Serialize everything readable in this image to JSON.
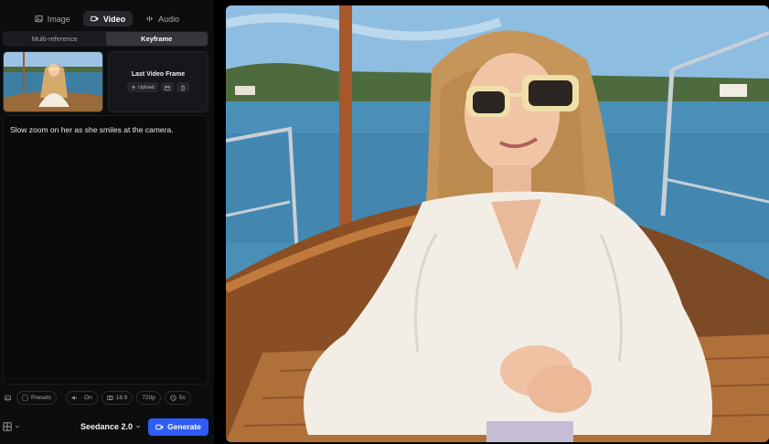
{
  "modes": [
    {
      "label": "Image",
      "icon": "image-icon",
      "active": false
    },
    {
      "label": "Video",
      "icon": "video-icon",
      "active": true
    },
    {
      "label": "Audio",
      "icon": "audio-icon",
      "active": false
    }
  ],
  "subtabs": [
    {
      "label": "Multi-reference",
      "active": false
    },
    {
      "label": "Keyframe",
      "active": true
    }
  ],
  "keyframes": {
    "last_title": "Last Video Frame",
    "upload_label": "Upload"
  },
  "prompt": {
    "text": "Slow zoom on her as she smiles at the camera."
  },
  "toolbar": {
    "presets_label": "Presets",
    "audio_label": "· On",
    "aspect_label": "16:9",
    "resolution_label": "720p",
    "duration_label": "5s"
  },
  "footer": {
    "model_label": "Seedance 2.0",
    "generate_label": "Generate"
  },
  "colors": {
    "accent": "#2f5cf5",
    "panel_bg": "#0c0d0f"
  }
}
